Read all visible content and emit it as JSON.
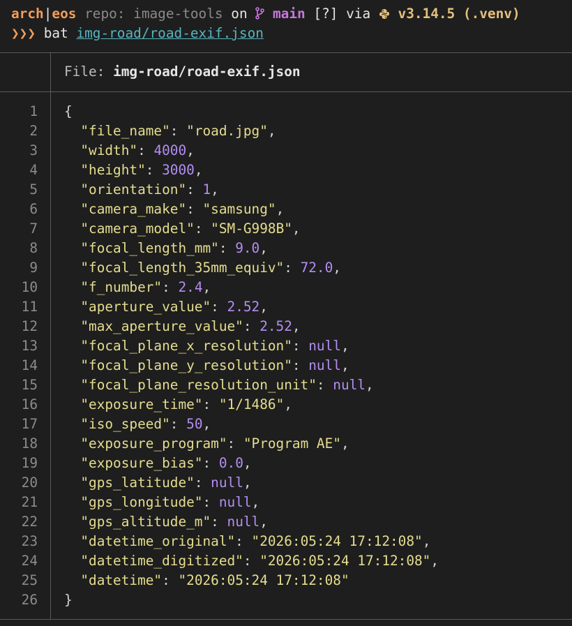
{
  "prompt": {
    "host": "arch",
    "separator": "|",
    "user": "eos",
    "repo_label": "repo: image-tools",
    "on_word": "on",
    "branch_icon": "git-branch-icon",
    "branch": "main",
    "status": "[?]",
    "via_word": "via",
    "python_icon": "python-icon",
    "python_version": "v3.14.5 (.venv)",
    "prompt_symbol": "❯❯❯",
    "command": "bat",
    "command_arg": "img-road/road-exif.json"
  },
  "file_header": {
    "label": "File:",
    "filename": "img-road/road-exif.json"
  },
  "code": {
    "open_brace": "{",
    "close_brace": "}",
    "entries": [
      {
        "key": "\"file_name\"",
        "value": "\"road.jpg\"",
        "type": "str",
        "comma": ","
      },
      {
        "key": "\"width\"",
        "value": "4000",
        "type": "num",
        "comma": ","
      },
      {
        "key": "\"height\"",
        "value": "3000",
        "type": "num",
        "comma": ","
      },
      {
        "key": "\"orientation\"",
        "value": "1",
        "type": "num",
        "comma": ","
      },
      {
        "key": "\"camera_make\"",
        "value": "\"samsung\"",
        "type": "str",
        "comma": ","
      },
      {
        "key": "\"camera_model\"",
        "value": "\"SM-G998B\"",
        "type": "str",
        "comma": ","
      },
      {
        "key": "\"focal_length_mm\"",
        "value": "9.0",
        "type": "num",
        "comma": ","
      },
      {
        "key": "\"focal_length_35mm_equiv\"",
        "value": "72.0",
        "type": "num",
        "comma": ","
      },
      {
        "key": "\"f_number\"",
        "value": "2.4",
        "type": "num",
        "comma": ","
      },
      {
        "key": "\"aperture_value\"",
        "value": "2.52",
        "type": "num",
        "comma": ","
      },
      {
        "key": "\"max_aperture_value\"",
        "value": "2.52",
        "type": "num",
        "comma": ","
      },
      {
        "key": "\"focal_plane_x_resolution\"",
        "value": "null",
        "type": "null",
        "comma": ","
      },
      {
        "key": "\"focal_plane_y_resolution\"",
        "value": "null",
        "type": "null",
        "comma": ","
      },
      {
        "key": "\"focal_plane_resolution_unit\"",
        "value": "null",
        "type": "null",
        "comma": ","
      },
      {
        "key": "\"exposure_time\"",
        "value": "\"1/1486\"",
        "type": "str",
        "comma": ","
      },
      {
        "key": "\"iso_speed\"",
        "value": "50",
        "type": "num",
        "comma": ","
      },
      {
        "key": "\"exposure_program\"",
        "value": "\"Program AE\"",
        "type": "str",
        "comma": ","
      },
      {
        "key": "\"exposure_bias\"",
        "value": "0.0",
        "type": "num",
        "comma": ","
      },
      {
        "key": "\"gps_latitude\"",
        "value": "null",
        "type": "null",
        "comma": ","
      },
      {
        "key": "\"gps_longitude\"",
        "value": "null",
        "type": "null",
        "comma": ","
      },
      {
        "key": "\"gps_altitude_m\"",
        "value": "null",
        "type": "null",
        "comma": ","
      },
      {
        "key": "\"datetime_original\"",
        "value": "\"2026:05:24 17:12:08\"",
        "type": "str",
        "comma": ","
      },
      {
        "key": "\"datetime_digitized\"",
        "value": "\"2026:05:24 17:12:08\"",
        "type": "str",
        "comma": ","
      },
      {
        "key": "\"datetime\"",
        "value": "\"2026:05:24 17:12:08\"",
        "type": "str",
        "comma": ""
      }
    ]
  },
  "line_numbers": [
    "1",
    "2",
    "3",
    "4",
    "5",
    "6",
    "7",
    "8",
    "9",
    "10",
    "11",
    "12",
    "13",
    "14",
    "15",
    "16",
    "17",
    "18",
    "19",
    "20",
    "21",
    "22",
    "23",
    "24",
    "25",
    "26"
  ],
  "colors": {
    "background": "#1e1e1e",
    "string": "#e5dd8f",
    "number": "#b48ef3",
    "accent_orange": "#f39c5a",
    "branch_magenta": "#c678dd",
    "python_yellow": "#e5c07b",
    "link_cyan": "#56b6c2"
  }
}
